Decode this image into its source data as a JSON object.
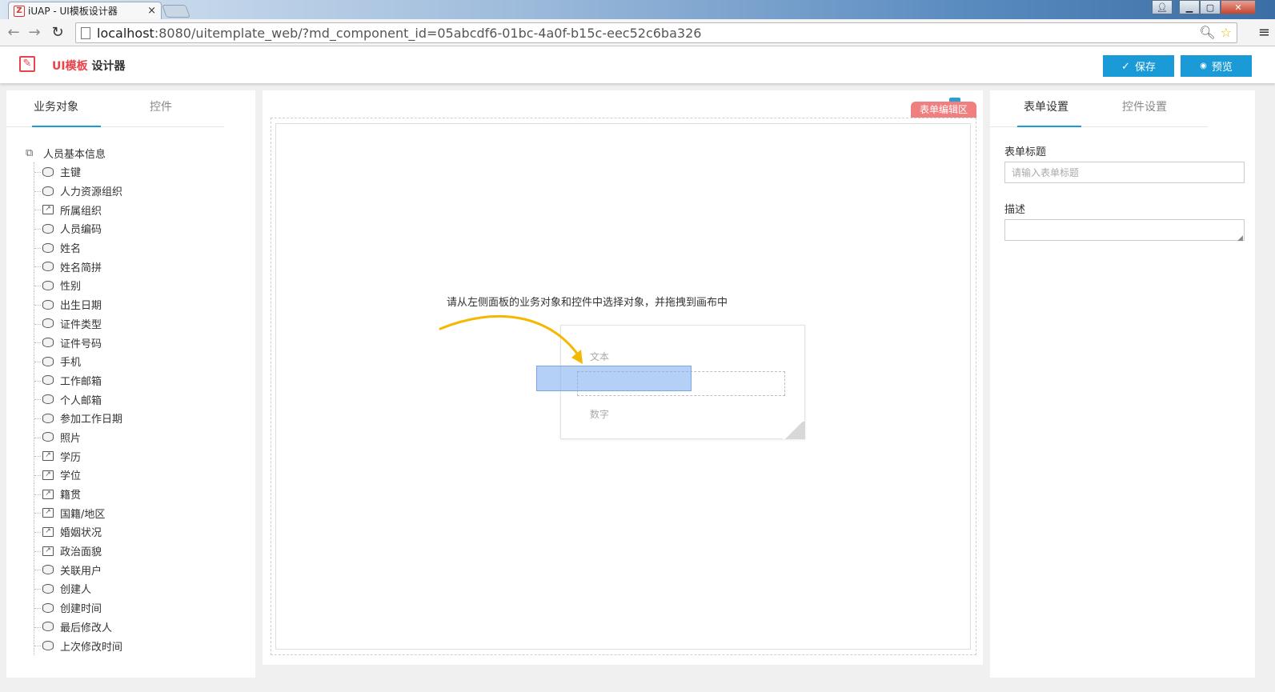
{
  "browser": {
    "tab_title": "iUAP - UI模板设计器",
    "tab_close": "×",
    "url_host": "localhost",
    "url_rest": ":8080/uitemplate_web/?md_component_id=05abcdf6-01bc-4a0f-b15c-eec52c6ba326",
    "back_glyph": "←",
    "forward_glyph": "→",
    "reload_glyph": "↻",
    "menu_glyph": "≡",
    "zoom_glyph": "🔍︎",
    "star_glyph": "☆",
    "min_glyph": "▁",
    "max_glyph": "▢",
    "close_glyph": "✕",
    "user_glyph": "👤︎"
  },
  "app": {
    "brand": "UI模板",
    "title_suffix": " 设计器",
    "save_label": "保存",
    "preview_label": "预览",
    "save_icon": "✓",
    "preview_icon": "◉",
    "accent": "#1a9ad7",
    "brand_color": "#e9424a"
  },
  "left": {
    "tabs": [
      "业务对象",
      "控件"
    ],
    "root": "人员基本信息",
    "items": [
      {
        "label": "主键",
        "icon": "db"
      },
      {
        "label": "人力资源组织",
        "icon": "db"
      },
      {
        "label": "所属组织",
        "icon": "ref"
      },
      {
        "label": "人员编码",
        "icon": "db"
      },
      {
        "label": "姓名",
        "icon": "db"
      },
      {
        "label": "姓名简拼",
        "icon": "db"
      },
      {
        "label": "性别",
        "icon": "db"
      },
      {
        "label": "出生日期",
        "icon": "db"
      },
      {
        "label": "证件类型",
        "icon": "db"
      },
      {
        "label": "证件号码",
        "icon": "db"
      },
      {
        "label": "手机",
        "icon": "db"
      },
      {
        "label": "工作邮箱",
        "icon": "db"
      },
      {
        "label": "个人邮箱",
        "icon": "db"
      },
      {
        "label": "参加工作日期",
        "icon": "db"
      },
      {
        "label": "照片",
        "icon": "db"
      },
      {
        "label": "学历",
        "icon": "ref"
      },
      {
        "label": "学位",
        "icon": "ref"
      },
      {
        "label": "籍贯",
        "icon": "ref"
      },
      {
        "label": "国籍/地区",
        "icon": "ref"
      },
      {
        "label": "婚姻状况",
        "icon": "ref"
      },
      {
        "label": "政治面貌",
        "icon": "ref"
      },
      {
        "label": "关联用户",
        "icon": "db"
      },
      {
        "label": "创建人",
        "icon": "db"
      },
      {
        "label": "创建时间",
        "icon": "db"
      },
      {
        "label": "最后修改人",
        "icon": "db"
      },
      {
        "label": "上次修改时间",
        "icon": "db"
      }
    ]
  },
  "canvas": {
    "badge": "表单编辑区",
    "hint": "请从左侧面板的业务对象和控件中选择对象，并拖拽到画布中",
    "demo_text_label": "文本",
    "demo_number_label": "数字"
  },
  "right": {
    "tabs": [
      "表单设置",
      "控件设置"
    ],
    "title_label": "表单标题",
    "title_placeholder": "请输入表单标题",
    "desc_label": "描述"
  }
}
